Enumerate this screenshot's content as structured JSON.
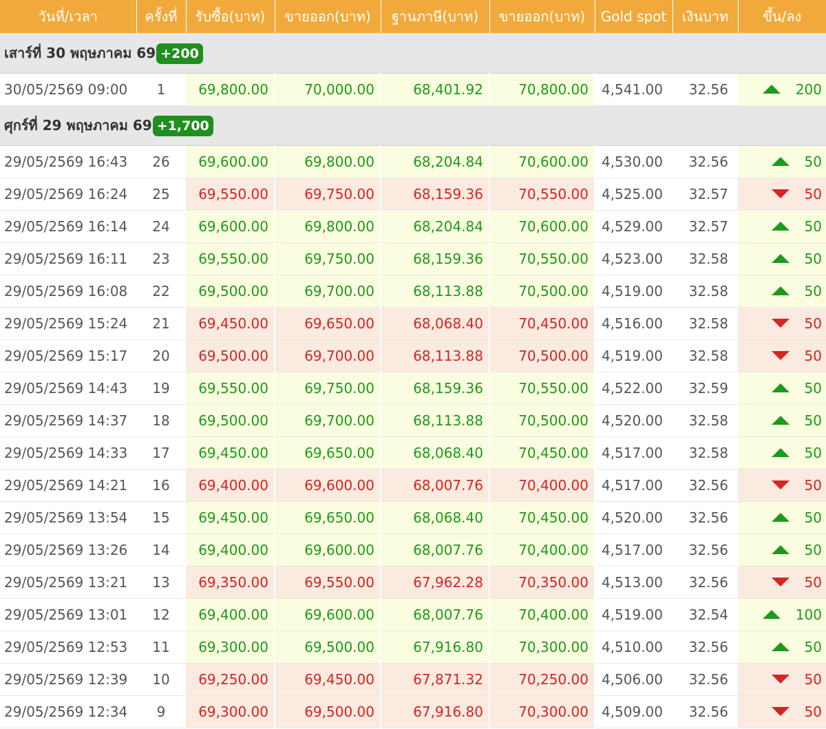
{
  "colors": {
    "header_bg": "#f2a93b",
    "up_text": "#1c9a1c",
    "down_text": "#d42424",
    "up_bg": "#fbfde0",
    "down_bg": "#fbeadf",
    "badge_bg": "#1f8f1f",
    "day_row_bg": "#e7e7e7"
  },
  "headers": [
    "วันที่/เวลา",
    "ครั้งที่",
    "รับซื้อ(บาท)",
    "ขายออก(บาท)",
    "ฐานภาษี(บาท)",
    "ขายออก(บาท)",
    "Gold spot",
    "เงินบาท",
    "ขึ้น/ลง"
  ],
  "groups": [
    {
      "label": "เสาร์ที่ 30 พฤษภาคม 69",
      "badge": "+200",
      "rows": [
        {
          "datetime": "30/05/2569 09:00",
          "round": "1",
          "buy": "69,800.00",
          "sell": "70,000.00",
          "tax_base": "68,401.92",
          "sell2": "70,800.00",
          "spot": "4,541.00",
          "thb": "32.56",
          "dir": "up",
          "change": "200"
        }
      ]
    },
    {
      "label": "ศุกร์ที่ 29 พฤษภาคม 69",
      "badge": "+1,700",
      "rows": [
        {
          "datetime": "29/05/2569 16:43",
          "round": "26",
          "buy": "69,600.00",
          "sell": "69,800.00",
          "tax_base": "68,204.84",
          "sell2": "70,600.00",
          "spot": "4,530.00",
          "thb": "32.56",
          "dir": "up",
          "change": "50"
        },
        {
          "datetime": "29/05/2569 16:24",
          "round": "25",
          "buy": "69,550.00",
          "sell": "69,750.00",
          "tax_base": "68,159.36",
          "sell2": "70,550.00",
          "spot": "4,525.00",
          "thb": "32.57",
          "dir": "down",
          "change": "50"
        },
        {
          "datetime": "29/05/2569 16:14",
          "round": "24",
          "buy": "69,600.00",
          "sell": "69,800.00",
          "tax_base": "68,204.84",
          "sell2": "70,600.00",
          "spot": "4,529.00",
          "thb": "32.57",
          "dir": "up",
          "change": "50"
        },
        {
          "datetime": "29/05/2569 16:11",
          "round": "23",
          "buy": "69,550.00",
          "sell": "69,750.00",
          "tax_base": "68,159.36",
          "sell2": "70,550.00",
          "spot": "4,523.00",
          "thb": "32.58",
          "dir": "up",
          "change": "50"
        },
        {
          "datetime": "29/05/2569 16:08",
          "round": "22",
          "buy": "69,500.00",
          "sell": "69,700.00",
          "tax_base": "68,113.88",
          "sell2": "70,500.00",
          "spot": "4,519.00",
          "thb": "32.58",
          "dir": "up",
          "change": "50"
        },
        {
          "datetime": "29/05/2569 15:24",
          "round": "21",
          "buy": "69,450.00",
          "sell": "69,650.00",
          "tax_base": "68,068.40",
          "sell2": "70,450.00",
          "spot": "4,516.00",
          "thb": "32.58",
          "dir": "down",
          "change": "50"
        },
        {
          "datetime": "29/05/2569 15:17",
          "round": "20",
          "buy": "69,500.00",
          "sell": "69,700.00",
          "tax_base": "68,113.88",
          "sell2": "70,500.00",
          "spot": "4,519.00",
          "thb": "32.58",
          "dir": "down",
          "change": "50"
        },
        {
          "datetime": "29/05/2569 14:43",
          "round": "19",
          "buy": "69,550.00",
          "sell": "69,750.00",
          "tax_base": "68,159.36",
          "sell2": "70,550.00",
          "spot": "4,522.00",
          "thb": "32.59",
          "dir": "up",
          "change": "50"
        },
        {
          "datetime": "29/05/2569 14:37",
          "round": "18",
          "buy": "69,500.00",
          "sell": "69,700.00",
          "tax_base": "68,113.88",
          "sell2": "70,500.00",
          "spot": "4,520.00",
          "thb": "32.58",
          "dir": "up",
          "change": "50"
        },
        {
          "datetime": "29/05/2569 14:33",
          "round": "17",
          "buy": "69,450.00",
          "sell": "69,650.00",
          "tax_base": "68,068.40",
          "sell2": "70,450.00",
          "spot": "4,517.00",
          "thb": "32.58",
          "dir": "up",
          "change": "50"
        },
        {
          "datetime": "29/05/2569 14:21",
          "round": "16",
          "buy": "69,400.00",
          "sell": "69,600.00",
          "tax_base": "68,007.76",
          "sell2": "70,400.00",
          "spot": "4,517.00",
          "thb": "32.56",
          "dir": "down",
          "change": "50"
        },
        {
          "datetime": "29/05/2569 13:54",
          "round": "15",
          "buy": "69,450.00",
          "sell": "69,650.00",
          "tax_base": "68,068.40",
          "sell2": "70,450.00",
          "spot": "4,520.00",
          "thb": "32.56",
          "dir": "up",
          "change": "50"
        },
        {
          "datetime": "29/05/2569 13:26",
          "round": "14",
          "buy": "69,400.00",
          "sell": "69,600.00",
          "tax_base": "68,007.76",
          "sell2": "70,400.00",
          "spot": "4,517.00",
          "thb": "32.56",
          "dir": "up",
          "change": "50"
        },
        {
          "datetime": "29/05/2569 13:21",
          "round": "13",
          "buy": "69,350.00",
          "sell": "69,550.00",
          "tax_base": "67,962.28",
          "sell2": "70,350.00",
          "spot": "4,513.00",
          "thb": "32.56",
          "dir": "down",
          "change": "50"
        },
        {
          "datetime": "29/05/2569 13:01",
          "round": "12",
          "buy": "69,400.00",
          "sell": "69,600.00",
          "tax_base": "68,007.76",
          "sell2": "70,400.00",
          "spot": "4,519.00",
          "thb": "32.54",
          "dir": "up",
          "change": "100"
        },
        {
          "datetime": "29/05/2569 12:53",
          "round": "11",
          "buy": "69,300.00",
          "sell": "69,500.00",
          "tax_base": "67,916.80",
          "sell2": "70,300.00",
          "spot": "4,510.00",
          "thb": "32.56",
          "dir": "up",
          "change": "50"
        },
        {
          "datetime": "29/05/2569 12:39",
          "round": "10",
          "buy": "69,250.00",
          "sell": "69,450.00",
          "tax_base": "67,871.32",
          "sell2": "70,250.00",
          "spot": "4,506.00",
          "thb": "32.56",
          "dir": "down",
          "change": "50"
        },
        {
          "datetime": "29/05/2569 12:34",
          "round": "9",
          "buy": "69,300.00",
          "sell": "69,500.00",
          "tax_base": "67,916.80",
          "sell2": "70,300.00",
          "spot": "4,509.00",
          "thb": "32.56",
          "dir": "down",
          "change": "50"
        }
      ]
    }
  ]
}
